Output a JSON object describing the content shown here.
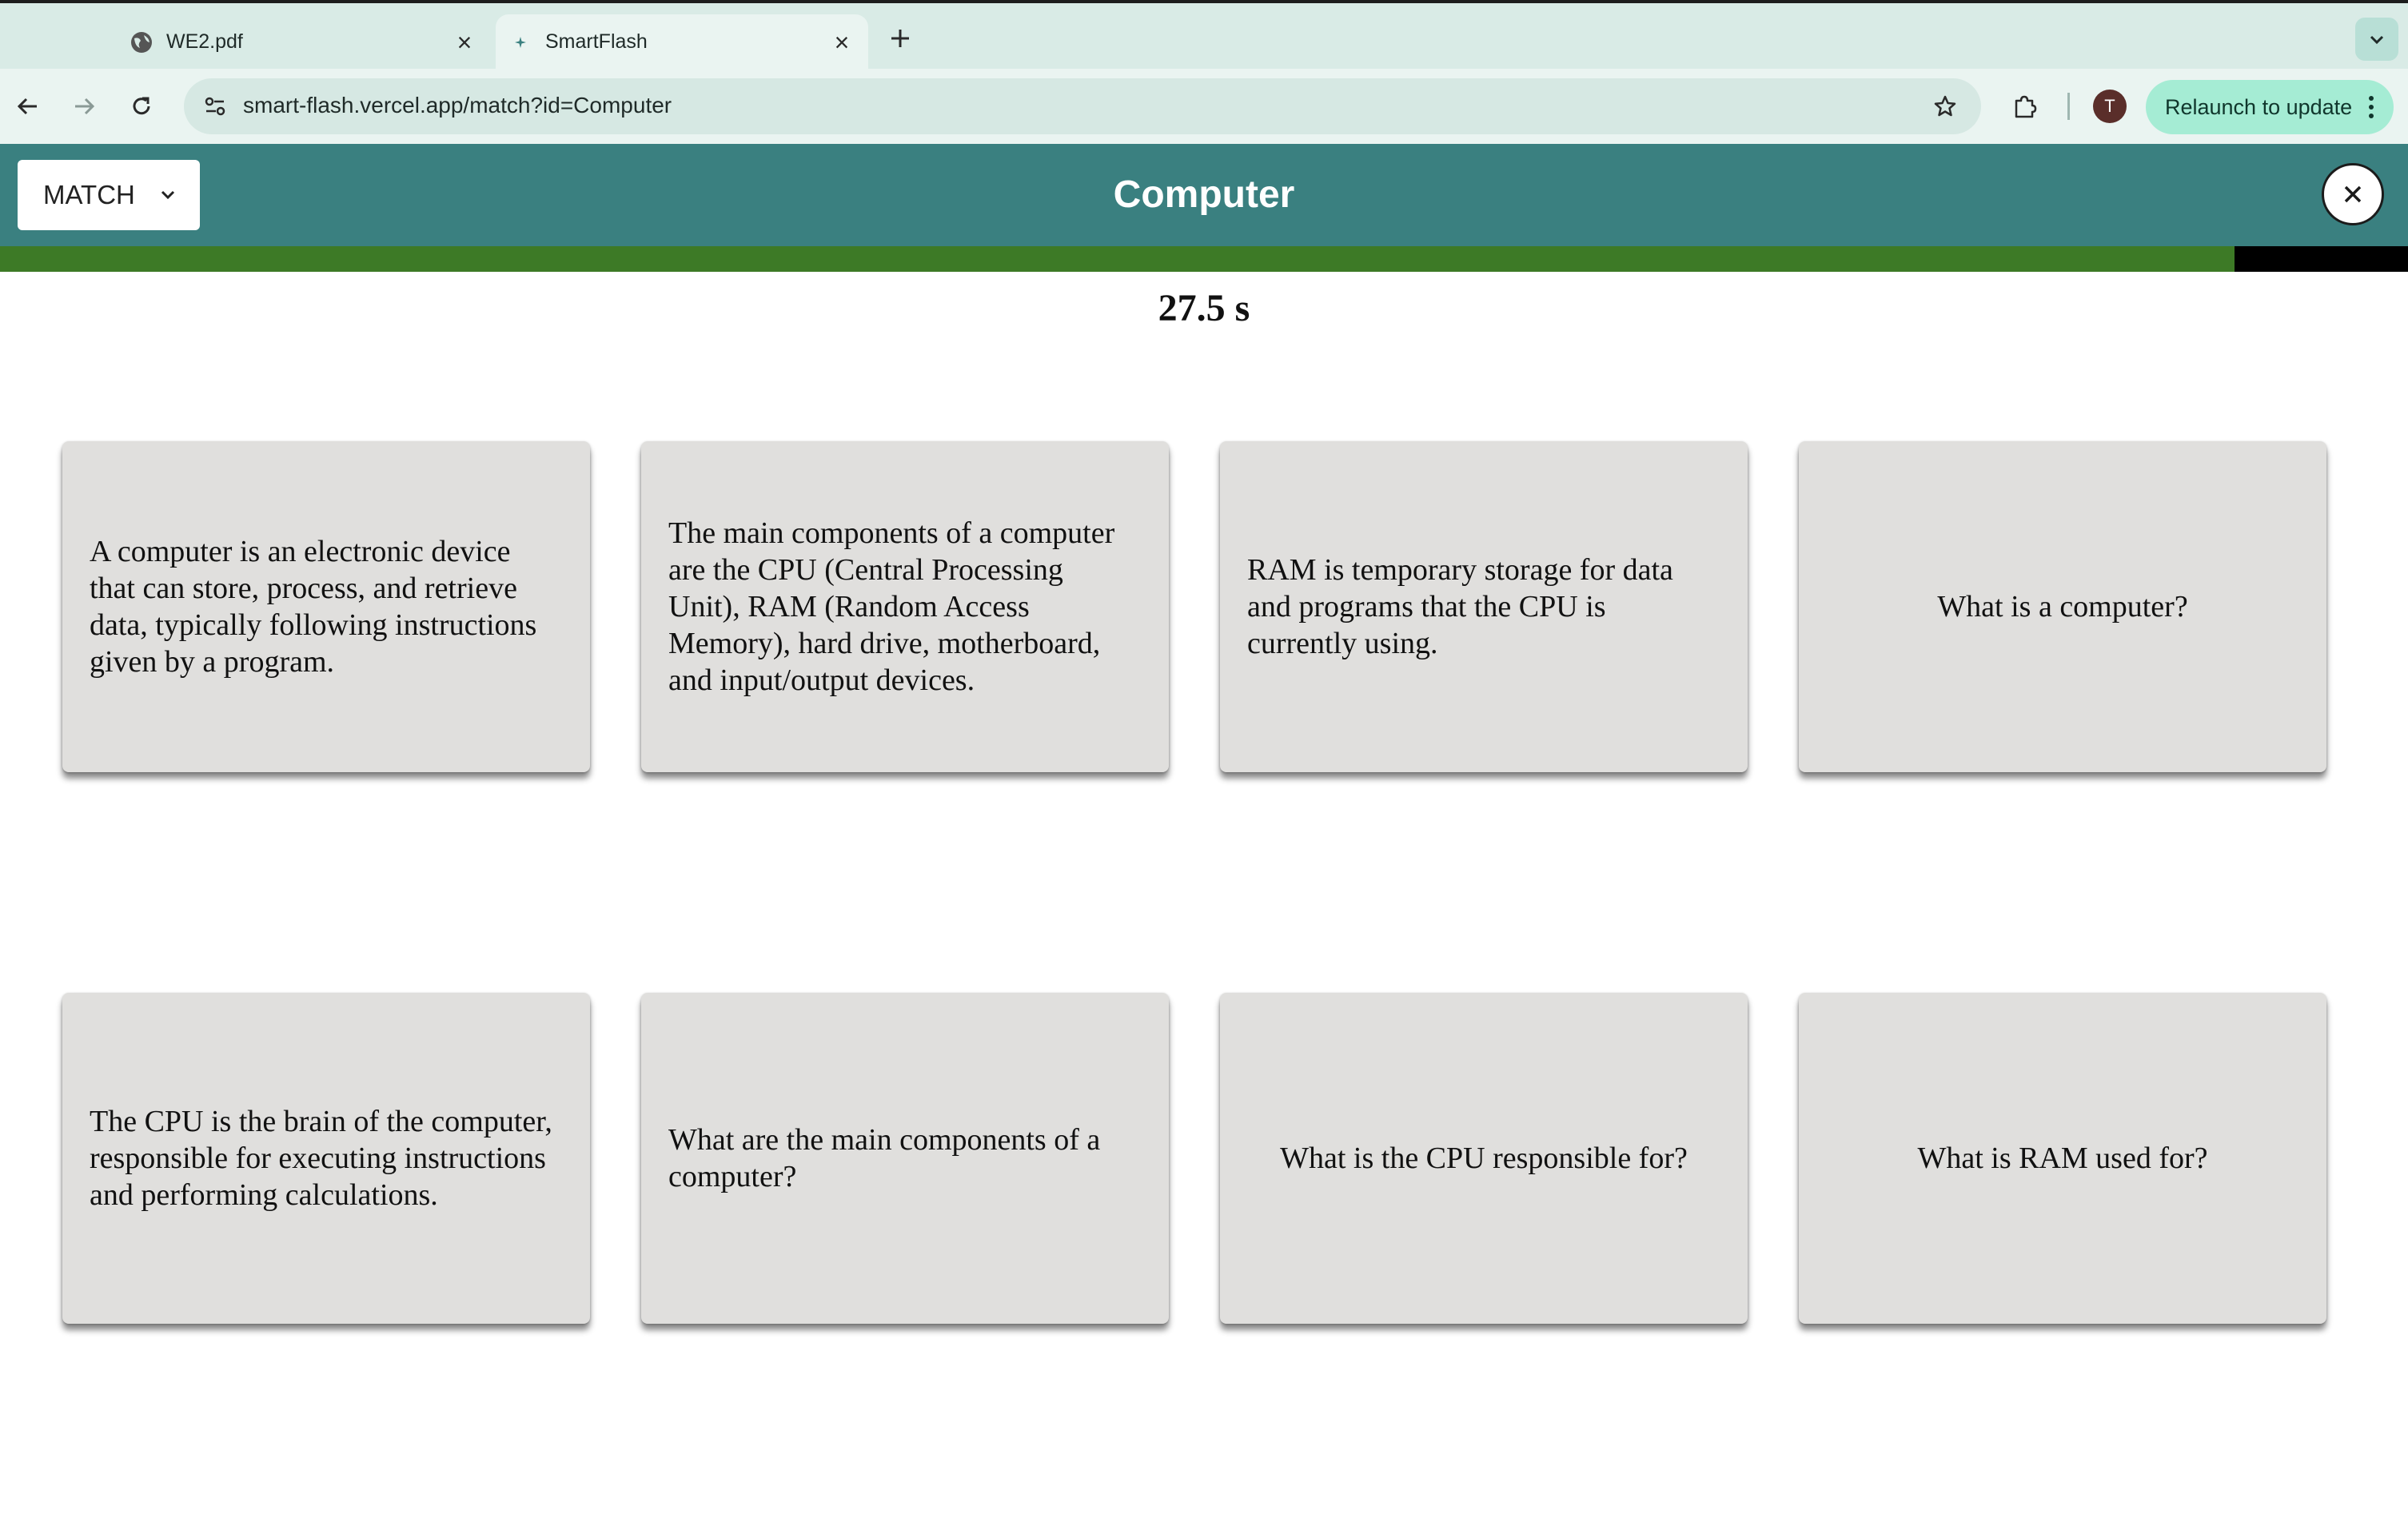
{
  "browser": {
    "tabs": [
      {
        "title": "WE2.pdf",
        "icon": "globe-icon",
        "active": false
      },
      {
        "title": "SmartFlash",
        "icon": "sparkle-icon",
        "active": true
      }
    ],
    "url": "smart-flash.vercel.app/match?id=Computer",
    "profile_initial": "T",
    "relaunch_label": "Relaunch to update"
  },
  "app": {
    "mode": "MATCH",
    "deck_title": "Computer",
    "timer": "27.5 s",
    "progress_fraction": 0.928,
    "colors": {
      "header": "#3a8080",
      "progress": "#3d7a26",
      "card": "#e0dfdd"
    }
  },
  "cards": [
    {
      "text": "A computer is an electronic device that can store, process, and retrieve data, typically following instructions given by a program."
    },
    {
      "text": "The main components of a computer are the CPU (Central Processing Unit), RAM (Random Access Memory), hard drive, motherboard, and input/output devices."
    },
    {
      "text": "RAM is temporary storage for data and programs that the CPU is currently using."
    },
    {
      "text": "What is a computer?"
    },
    {
      "text": "The CPU is the brain of the computer, responsible for executing instructions and performing calculations."
    },
    {
      "text": "What are the main components of a computer?"
    },
    {
      "text": "What is the CPU responsible for?"
    },
    {
      "text": "What is RAM used for?"
    }
  ]
}
